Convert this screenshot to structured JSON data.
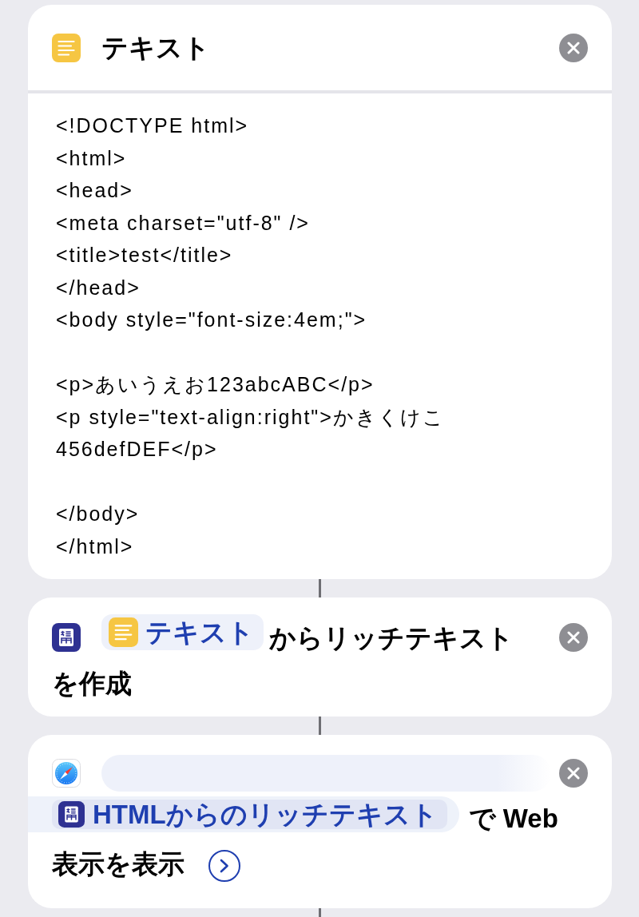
{
  "actions": [
    {
      "kind": "text",
      "title": "テキスト",
      "text_blocks": [
        [
          "<!DOCTYPE html>",
          "<html>",
          "<head>",
          "<meta charset=\"utf-8\" />",
          "<title>test</title>",
          "</head>",
          "<body style=\"font-size:4em;\">"
        ],
        [
          "<p>あいうえお123abcABC</p>",
          "<p style=\"text-align:right\">かきくけこ",
          "456defDEF</p>"
        ],
        [
          "</body>",
          "</html>"
        ]
      ]
    },
    {
      "kind": "richtext",
      "parts": [
        {
          "kind": "text-variable",
          "text": "テキスト",
          "selected": false
        },
        {
          "kind": "plain",
          "text": "からリッチテキスト"
        },
        {
          "kind": "plain",
          "text": "を作成"
        }
      ]
    },
    {
      "kind": "webview",
      "parts": [
        {
          "kind": "richtext-variable",
          "text": "HTMLからのリッチテキスト",
          "selected": true
        },
        {
          "kind": "plain",
          "text": "で Web"
        },
        {
          "kind": "plain",
          "text": "表示を表示"
        },
        {
          "kind": "expand",
          "expanded": false
        }
      ]
    }
  ]
}
